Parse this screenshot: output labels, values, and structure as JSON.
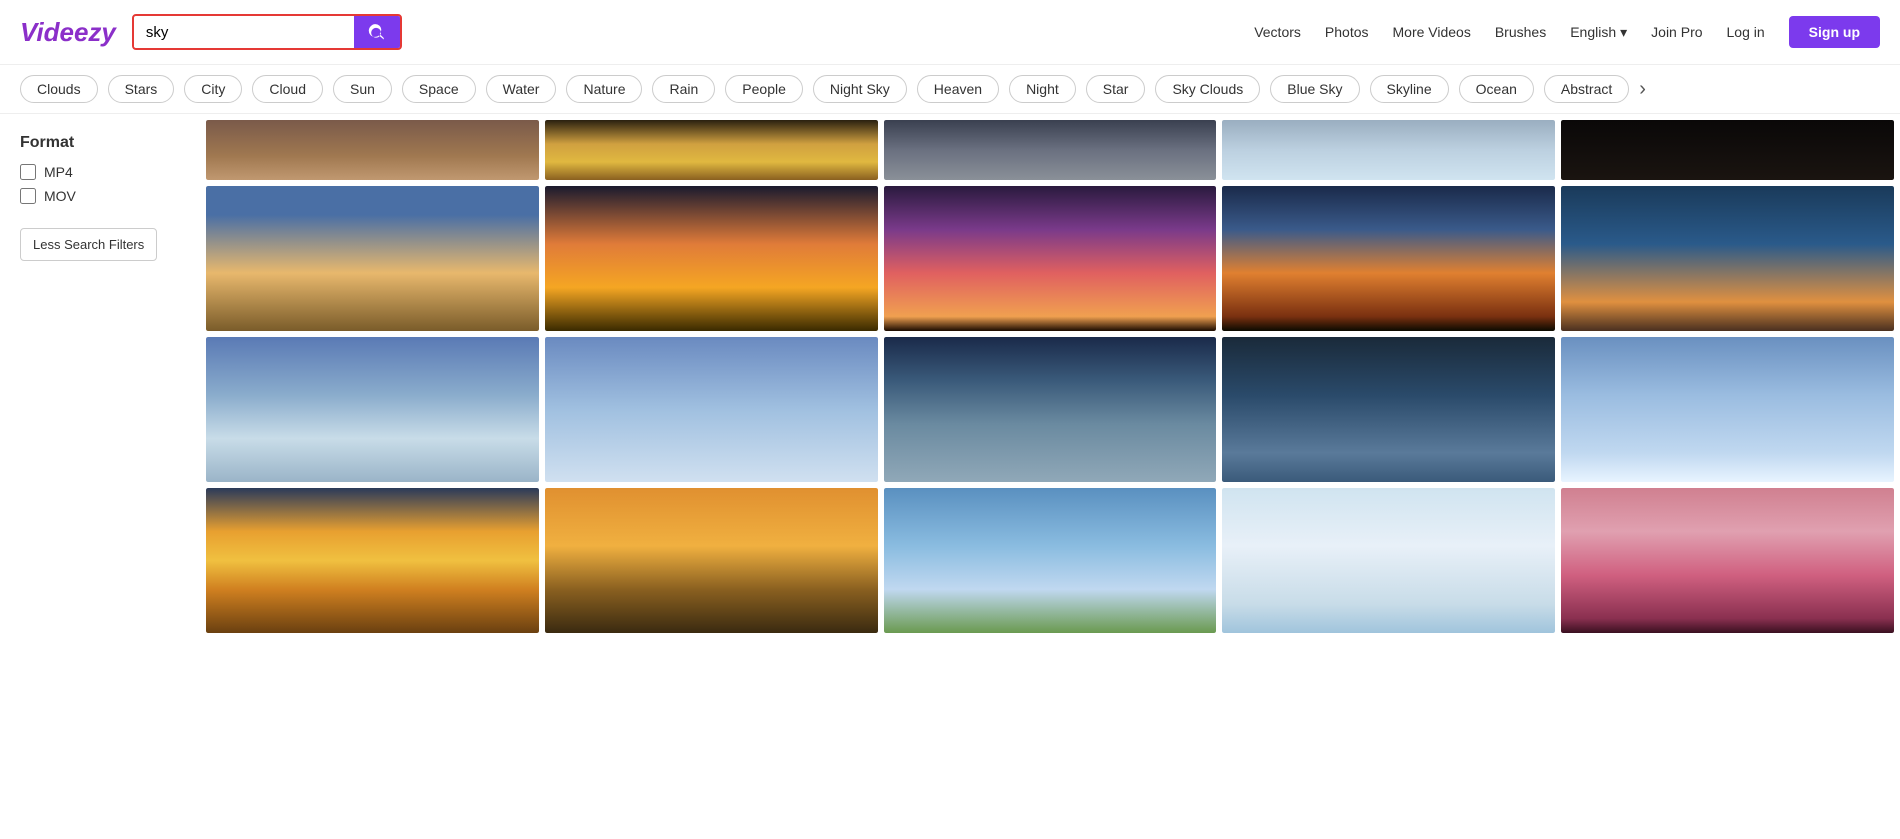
{
  "header": {
    "logo": "Videezy",
    "search": {
      "value": "sky",
      "placeholder": "sky"
    },
    "nav": {
      "vectors": "Vectors",
      "photos": "Photos",
      "more_videos": "More Videos",
      "brushes": "Brushes",
      "language": "English",
      "join_pro": "Join Pro",
      "log_in": "Log in",
      "sign_up": "Sign up"
    }
  },
  "tags": {
    "items": [
      "Clouds",
      "Stars",
      "City",
      "Cloud",
      "Sun",
      "Space",
      "Water",
      "Nature",
      "Rain",
      "People",
      "Night Sky",
      "Heaven",
      "Night",
      "Star",
      "Sky Clouds",
      "Blue Sky",
      "Skyline",
      "Ocean",
      "Abstract"
    ],
    "arrow_label": "›"
  },
  "sidebar": {
    "format_title": "Format",
    "formats": [
      {
        "label": "MP4",
        "checked": false
      },
      {
        "label": "MOV",
        "checked": false
      }
    ],
    "less_filters_btn": "Less Search Filters"
  },
  "grid": {
    "top_row": [
      {
        "class": "sky-t1"
      },
      {
        "class": "sky-t2"
      },
      {
        "class": "sky-t3"
      },
      {
        "class": "sky-t4"
      },
      {
        "class": "sky-t5"
      }
    ],
    "row1": [
      {
        "class": "sky-1"
      },
      {
        "class": "sky-2"
      },
      {
        "class": "sky-3"
      },
      {
        "class": "sky-4"
      },
      {
        "class": "sky-5"
      }
    ],
    "row2": [
      {
        "class": "sky-6"
      },
      {
        "class": "sky-7"
      },
      {
        "class": "sky-8"
      },
      {
        "class": "sky-9"
      },
      {
        "class": "sky-10"
      }
    ],
    "row3": [
      {
        "class": "sky-11"
      },
      {
        "class": "sky-12"
      },
      {
        "class": "sky-13"
      },
      {
        "class": "sky-14"
      },
      {
        "class": "sky-15"
      }
    ]
  },
  "colors": {
    "brand_purple": "#7c3aed",
    "logo_color": "#8b2fc9",
    "search_border_red": "#e53935"
  }
}
